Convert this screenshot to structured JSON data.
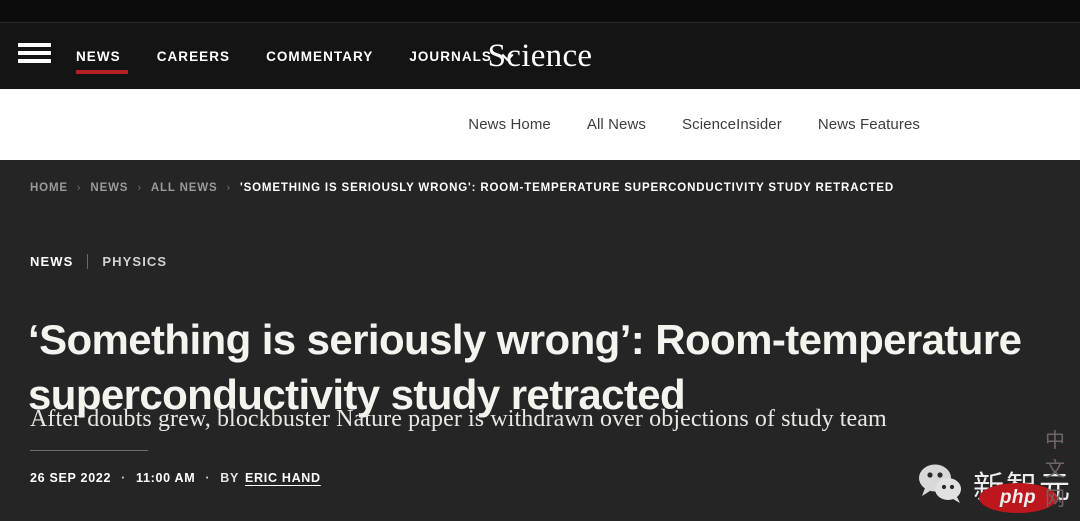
{
  "topnav": {
    "menu_icon": "hamburger-menu-icon",
    "items": [
      {
        "label": "NEWS",
        "active": true
      },
      {
        "label": "CAREERS",
        "active": false
      },
      {
        "label": "COMMENTARY",
        "active": false
      },
      {
        "label": "JOURNALS",
        "active": false,
        "caret": "chevron-down-icon"
      }
    ],
    "brand": "Science",
    "accent_color": "#b22026"
  },
  "subnav": {
    "items": [
      {
        "label": "News Home"
      },
      {
        "label": "All News"
      },
      {
        "label": "ScienceInsider"
      },
      {
        "label": "News Features"
      }
    ]
  },
  "breadcrumb": {
    "items": [
      {
        "label": "HOME"
      },
      {
        "label": "NEWS"
      },
      {
        "label": "ALL NEWS"
      },
      {
        "label": "'SOMETHING IS SERIOUSLY WRONG': ROOM-TEMPERATURE SUPERCONDUCTIVITY STUDY RETRACTED"
      }
    ],
    "separator": "›"
  },
  "article": {
    "kicker_section": "NEWS",
    "kicker_topic": "PHYSICS",
    "headline": "‘Something is seriously wrong’: Room-temperature superconductivity study retracted",
    "deck": "After doubts grew, blockbuster Nature paper is withdrawn over objections of study team",
    "date": "26 SEP 2022",
    "time": "11:00 AM",
    "by_label": "BY",
    "author": "ERIC HAND",
    "separator_dot": "·"
  },
  "watermark": {
    "icon": "wechat-icon",
    "name": "新智元",
    "badge": "php",
    "sub": "中文网",
    "badge_color": "#c8161d"
  }
}
